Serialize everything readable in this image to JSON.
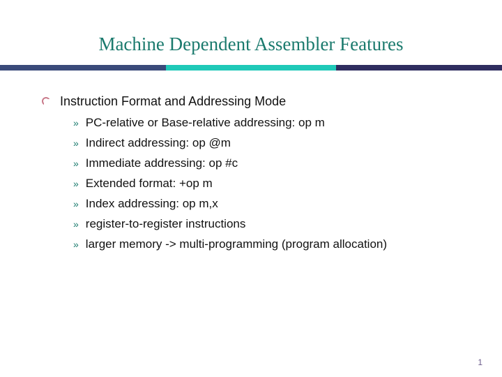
{
  "title": "Machine Dependent Assembler Features",
  "main": {
    "heading": "Instruction Format and Addressing Mode",
    "items": [
      "PC-relative or Base-relative addressing: op m",
      "Indirect addressing: op @m",
      "Immediate addressing: op #c",
      "Extended format: +op m",
      "Index addressing: op m,x",
      "register-to-register instructions",
      "larger memory -> multi-programming (program allocation)"
    ]
  },
  "pageNumber": "1"
}
